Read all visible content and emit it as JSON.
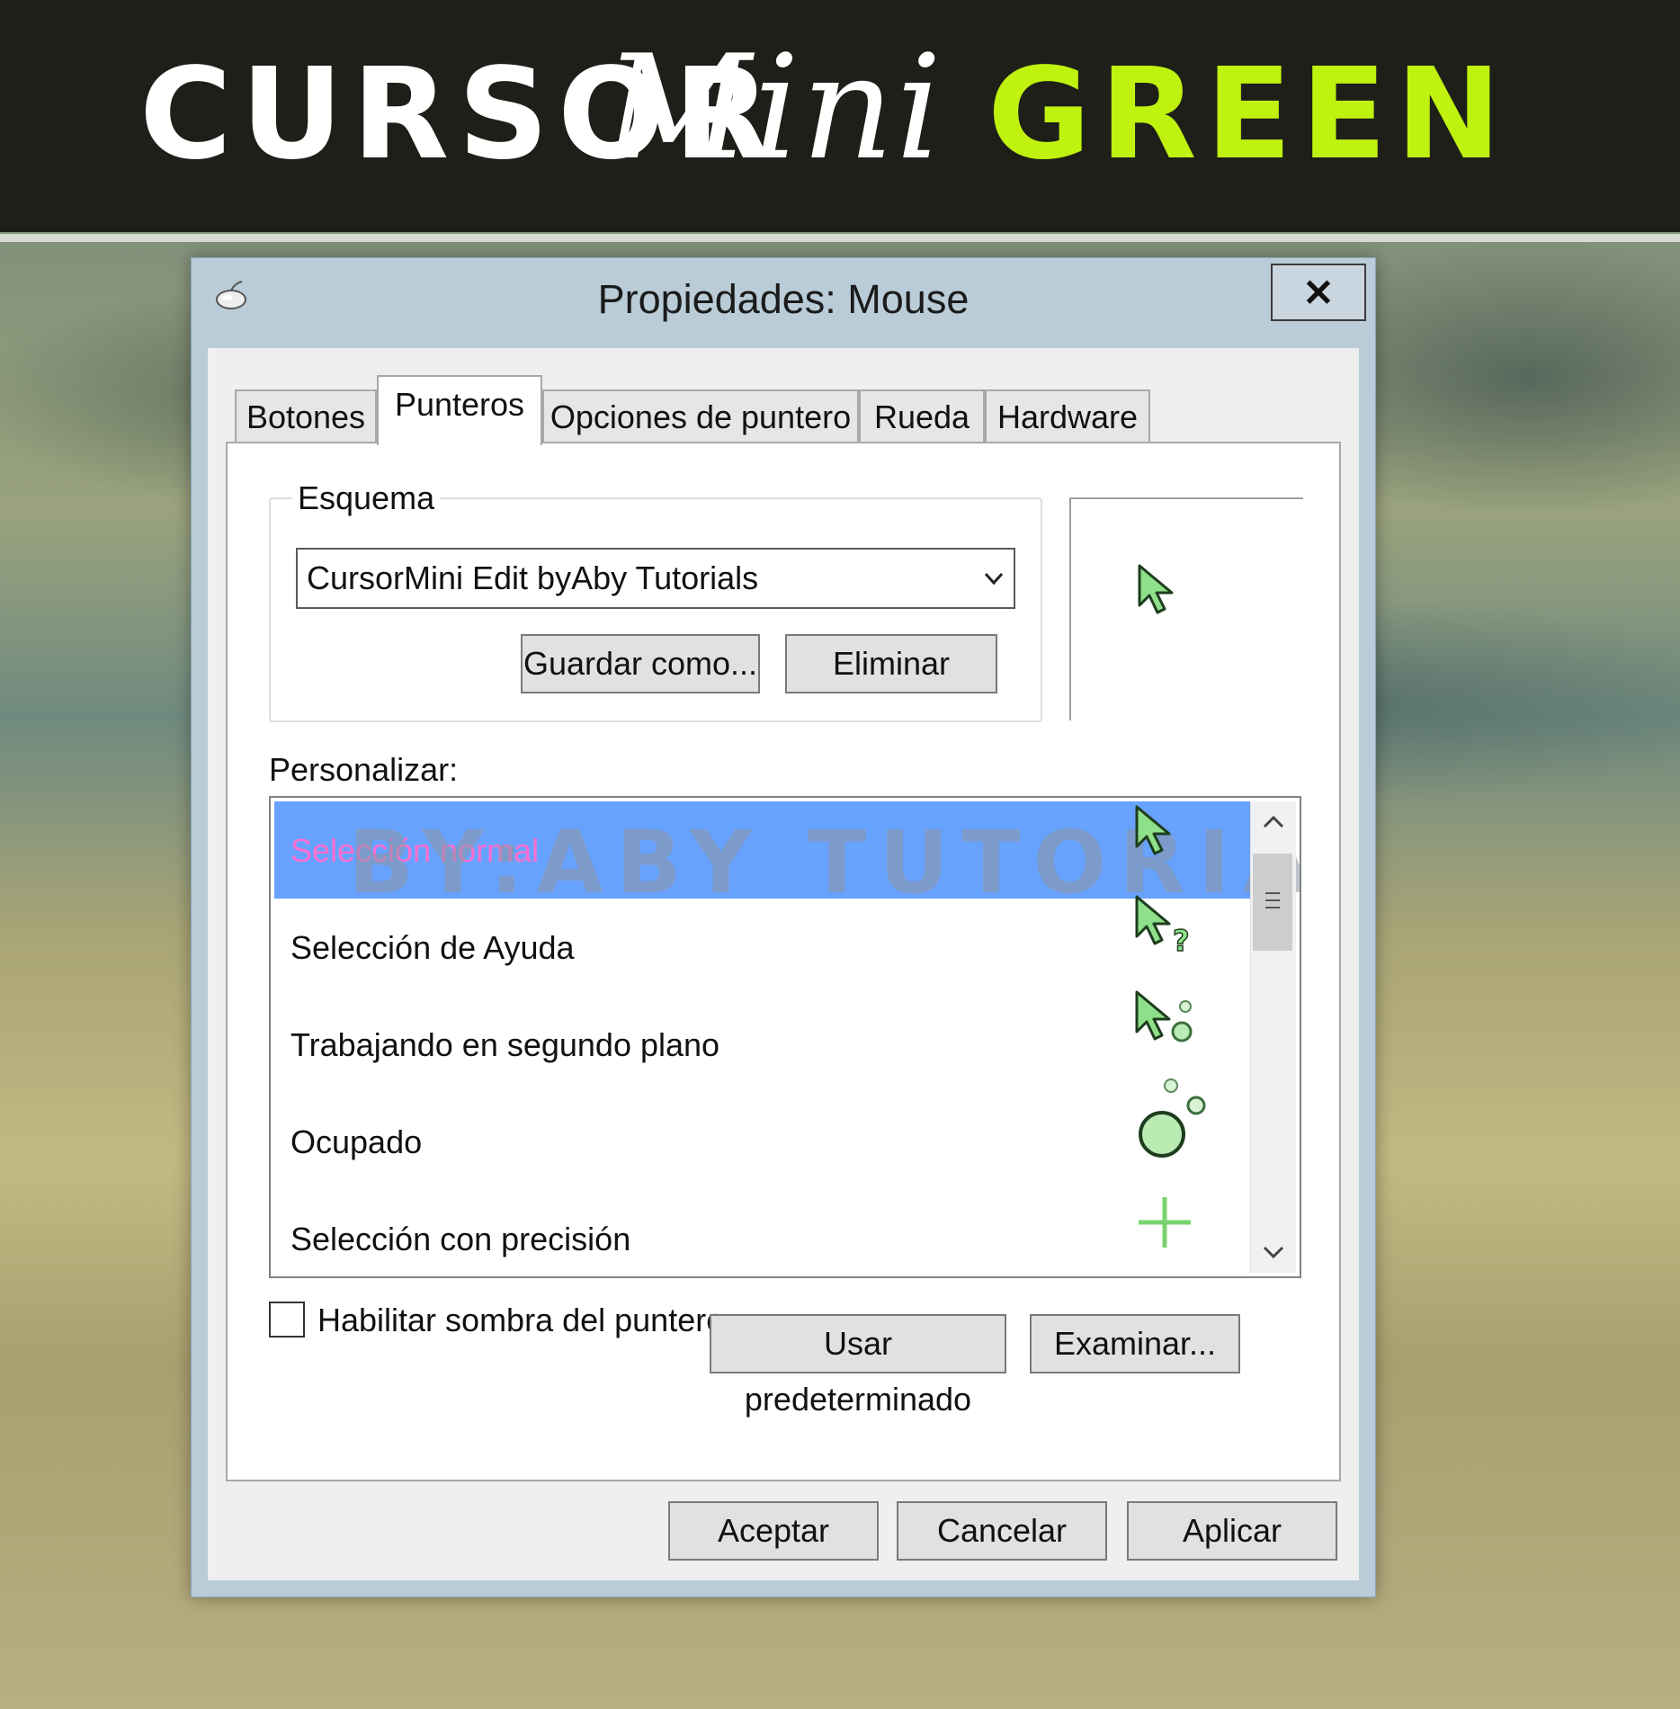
{
  "banner": {
    "word1": "CURSOR",
    "word2": "Mini",
    "word3": "GREEN",
    "accent_color": "#bff20f"
  },
  "window": {
    "title": "Propiedades: Mouse",
    "icon": "mouse-icon",
    "close_label": "✕"
  },
  "tabs": [
    {
      "label": "Botones",
      "active": false
    },
    {
      "label": "Punteros",
      "active": true
    },
    {
      "label": "Opciones de puntero",
      "active": false
    },
    {
      "label": "Rueda",
      "active": false
    },
    {
      "label": "Hardware",
      "active": false
    }
  ],
  "scheme": {
    "group_label": "Esquema",
    "selected": "CursorMini Edit byAby Tutorials",
    "save_as_label": "Guardar como...",
    "delete_label": "Eliminar"
  },
  "customize": {
    "label": "Personalizar:",
    "watermark": "BY:ABY   TUTORIALS",
    "items": [
      {
        "label": "Selección normal",
        "icon": "green-arrow-cursor-icon",
        "selected": true
      },
      {
        "label": "Selección de Ayuda",
        "icon": "green-help-cursor-icon",
        "selected": false
      },
      {
        "label": "Trabajando en segundo plano",
        "icon": "green-working-cursor-icon",
        "selected": false
      },
      {
        "label": "Ocupado",
        "icon": "green-busy-cursor-icon",
        "selected": false
      },
      {
        "label": "Selección con precisión",
        "icon": "green-crosshair-cursor-icon",
        "selected": false
      }
    ]
  },
  "shadow_option": {
    "label": "Habilitar sombra del puntero",
    "checked": false
  },
  "buttons": {
    "use_default": "Usar predeterminado",
    "browse": "Examinar...",
    "ok": "Aceptar",
    "cancel": "Cancelar",
    "apply": "Aplicar"
  },
  "colors": {
    "cursor_fill": "#8fe08a",
    "selection": "#68a2ff",
    "selected_text": "#ff6fd0"
  }
}
